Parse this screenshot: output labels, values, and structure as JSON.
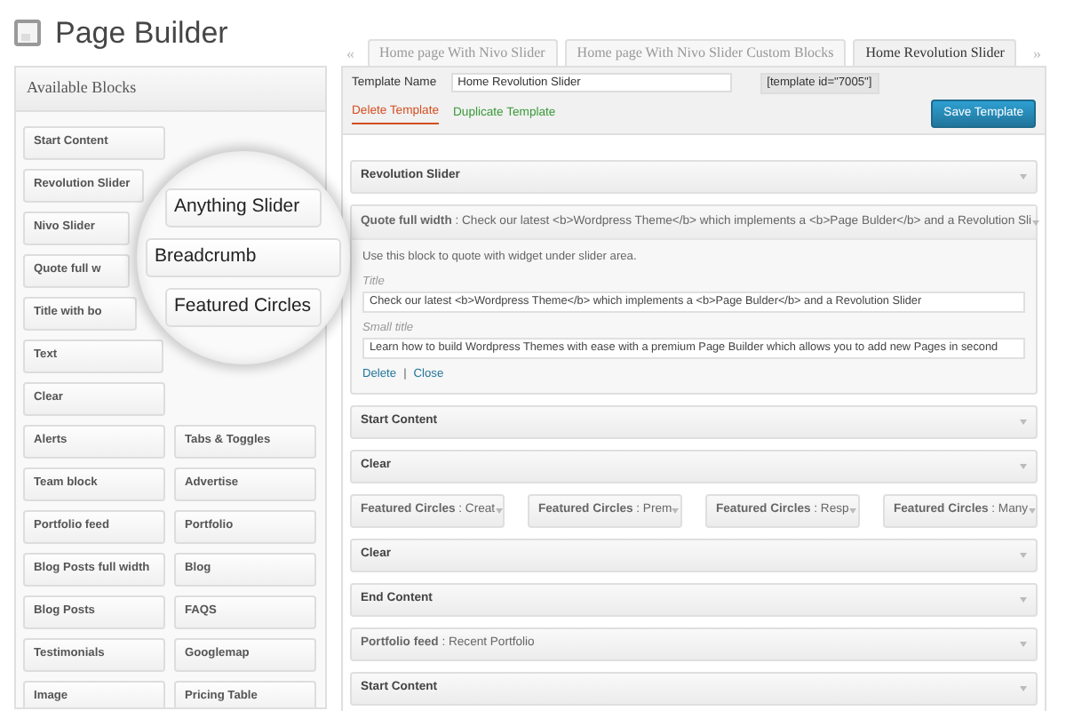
{
  "page_title": "Page Builder",
  "sidebar": {
    "title": "Available Blocks",
    "rows": [
      {
        "left": "Start Content"
      },
      {
        "left": "Revolution Slider"
      },
      {
        "left": "Nivo Slider"
      },
      {
        "left": "Quote full w"
      },
      {
        "left": "Title with bo"
      },
      {
        "left": "Text"
      },
      {
        "left": "Clear"
      },
      {
        "left": "Alerts",
        "right": "Tabs & Toggles"
      },
      {
        "left": "Team block",
        "right": "Advertise"
      },
      {
        "left": "Portfolio feed",
        "right": "Portfolio"
      },
      {
        "left": "Blog Posts full width",
        "right": "Blog"
      },
      {
        "left": "Blog Posts",
        "right": "FAQS"
      },
      {
        "left": "Testimonials",
        "right": "Googlemap"
      },
      {
        "left": "Image",
        "right": "Pricing Table"
      }
    ]
  },
  "magnifier": {
    "items": [
      "Anything Slider",
      "Breadcrumb",
      "Featured Circles"
    ]
  },
  "tab_prev": "«",
  "tab_next": "»",
  "tabs": [
    {
      "label": "Home page With Nivo Slider",
      "selected": false
    },
    {
      "label": "Home page With Nivo Slider Custom Blocks",
      "selected": false
    },
    {
      "label": "Home Revolution Slider",
      "selected": true
    }
  ],
  "template": {
    "name_label": "Template Name",
    "name_value": "Home Revolution Slider",
    "shortcode": "[template id=\"7005\"]",
    "delete": "Delete Template",
    "duplicate": "Duplicate Template",
    "save": "Save Template"
  },
  "builder_rows": [
    {
      "kind": "bar",
      "title": "Revolution Slider"
    },
    {
      "kind": "expanded",
      "title": "**Quote full width** : Check our latest <b>Wordpress Theme</b> which implements a <b>Page Bulder</b> and a Revolution Sli",
      "description": "Use this block to quote with widget under slider area.",
      "fields": [
        {
          "label": "Title",
          "value": "Check our latest <b>Wordpress Theme</b> which implements a <b>Page Bulder</b> and a Revolution Slider"
        },
        {
          "label": "Small title",
          "value": "Learn how to build Wordpress Themes with ease with a premium Page Builder which allows you to add new Pages in second"
        }
      ],
      "actions": [
        "Delete",
        "Close"
      ],
      "action_separator": "|"
    },
    {
      "kind": "bar",
      "title": "Start Content"
    },
    {
      "kind": "bar",
      "title": "Clear"
    },
    {
      "kind": "inline",
      "items": [
        {
          "title": "**Featured Circles** : Creat"
        },
        {
          "title": "**Featured Circles** : Prem"
        },
        {
          "title": "**Featured Circles** : Resp"
        },
        {
          "title": "**Featured Circles** : Many"
        }
      ]
    },
    {
      "kind": "bar",
      "title": "Clear"
    },
    {
      "kind": "bar",
      "title": "End Content"
    },
    {
      "kind": "bar",
      "title": "**Portfolio feed** : Recent Portfolio"
    },
    {
      "kind": "bar",
      "title": "Start Content"
    }
  ]
}
